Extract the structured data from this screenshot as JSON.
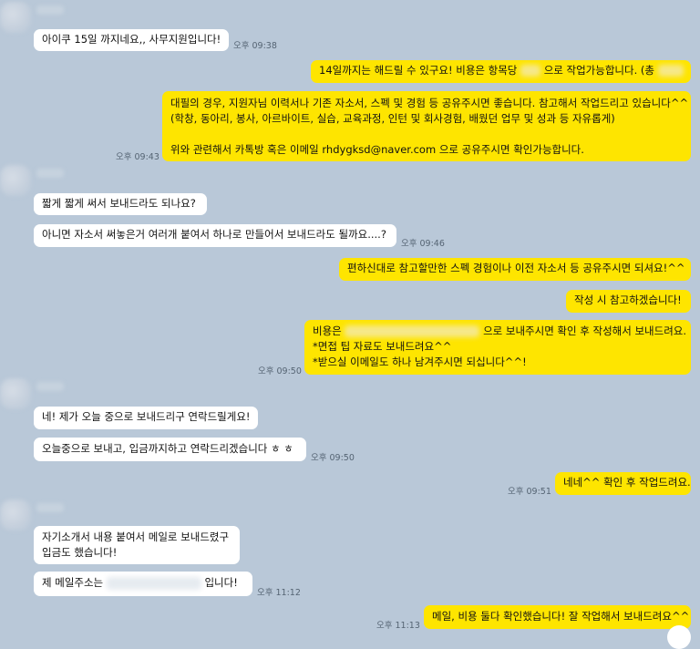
{
  "messages": [
    {
      "id": "m1",
      "side": "left",
      "text": "아이쿠 15일 까지네요,, 사무지원입니다!",
      "time": "오후 09:38"
    },
    {
      "id": "m2",
      "side": "right",
      "text_before": "14일까지는 해드릴 수 있구요! 비용은 항목당",
      "text_after": "으로 작업가능합니다. (총"
    },
    {
      "id": "m3",
      "side": "right",
      "lines": [
        "대필의 경우, 지원자님 이력서나 기존 자소서, 스펙 및 경험 등 공유주시면 좋습니다. 참고해서 작업드리고 있습니다^^",
        "(학창, 동아리, 봉사, 아르바이트, 실습, 교육과정, 인턴 및 회사경험, 배웠던 업무 및 성과 등 자유롭게)",
        "",
        "위와 관련해서 카톡방 혹은 이메일 rhdygksd@naver.com 으로 공유주시면 확인가능합니다."
      ],
      "time": "오후 09:43"
    },
    {
      "id": "m4",
      "side": "left",
      "text": "짧게 짧게 써서 보내드라도 되나요?"
    },
    {
      "id": "m5",
      "side": "left",
      "text": "아니면 자소서 써놓은거 여러개 붙여서 하나로 만들어서 보내드라도 될까요....?",
      "time": "오후 09:46"
    },
    {
      "id": "m6",
      "side": "right",
      "text": "편하신대로 참고할만한 스펙 경험이나 이전 자소서 등 공유주시면 되셔요!^^"
    },
    {
      "id": "m7",
      "side": "right",
      "text": "작성 시 참고하겠습니다!"
    },
    {
      "id": "m8",
      "side": "right",
      "line1_before": "비용은",
      "line1_after": "으로 보내주시면 확인 후 작성해서 보내드려요.",
      "line2": "*면접 팁 자료도 보내드려요^^",
      "line3": "*받으실 이메일도 하나 남겨주시면 되십니다^^!",
      "time": "오후 09:50"
    },
    {
      "id": "m9",
      "side": "left",
      "text": "네! 제가 오늘 중으로 보내드리구 연락드릴게요!"
    },
    {
      "id": "m10",
      "side": "left",
      "text": "오늘중으로 보내고, 입금까지하고 연락드리겠습니다 ㅎ ㅎ",
      "time": "오후 09:50"
    },
    {
      "id": "m11",
      "side": "right",
      "text": "네네^^ 확인 후 작업드려요.",
      "time": "오후 09:51"
    },
    {
      "id": "m12",
      "side": "left",
      "line1": "자기소개서 내용 붙여서 메일로 보내드렸구",
      "line2": "입금도 했습니다!"
    },
    {
      "id": "m13",
      "side": "left",
      "text_before": "제 메일주소는",
      "text_after": "입니다!",
      "time": "오후 11:12"
    },
    {
      "id": "m14",
      "side": "right",
      "text": "메일, 비용 둘다 확인했습니다! 잘 작업해서 보내드려요^^",
      "time": "오후 11:13"
    }
  ]
}
